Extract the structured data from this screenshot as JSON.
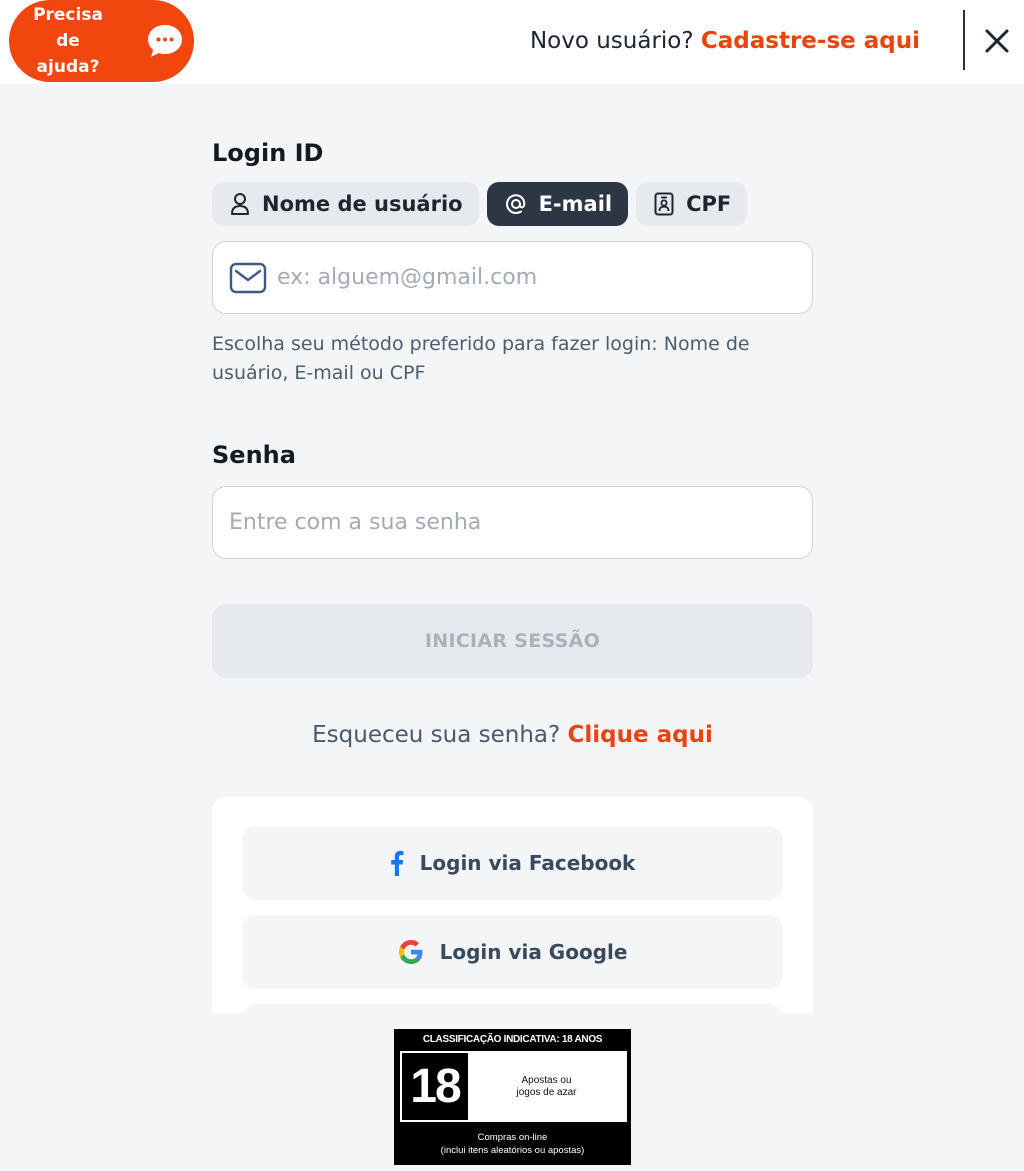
{
  "header": {
    "help_label": "Precisa\nde\najuda?",
    "new_user_text": "Novo usuário?",
    "signup_link": "Cadastre-se aqui",
    "close_icon": "close-icon"
  },
  "login": {
    "login_id_label": "Login ID",
    "tabs": [
      {
        "label": "Nome de usuário",
        "icon": "user-icon",
        "active": false
      },
      {
        "label": "E-mail",
        "icon": "at-icon",
        "active": true
      },
      {
        "label": "CPF",
        "icon": "id-card-icon",
        "active": false
      }
    ],
    "email_placeholder": "ex: alguem@gmail.com",
    "hint": "Escolha seu método preferido para fazer login: Nome de usuário, E-mail ou CPF",
    "password_label": "Senha",
    "password_placeholder": "Entre com a sua senha",
    "submit_label": "INICIAR SESSÃO",
    "forgot_text": "Esqueceu sua senha?",
    "forgot_link": "Clique aqui"
  },
  "social": {
    "facebook_label": "Login via Facebook",
    "google_label": "Login via Google"
  },
  "rating": {
    "title": "CLASSIFICAÇÃO INDICATIVA: 18 ANOS",
    "age": "18",
    "description": "Apostas ou\njogos de azar",
    "footer": "Compras on-line\n(inclui itens aleatórios ou apostas)"
  },
  "colors": {
    "accent": "#e8450e",
    "help_pill": "#f2460f",
    "active_tab": "#2d3644",
    "background": "#f3f5f7"
  }
}
